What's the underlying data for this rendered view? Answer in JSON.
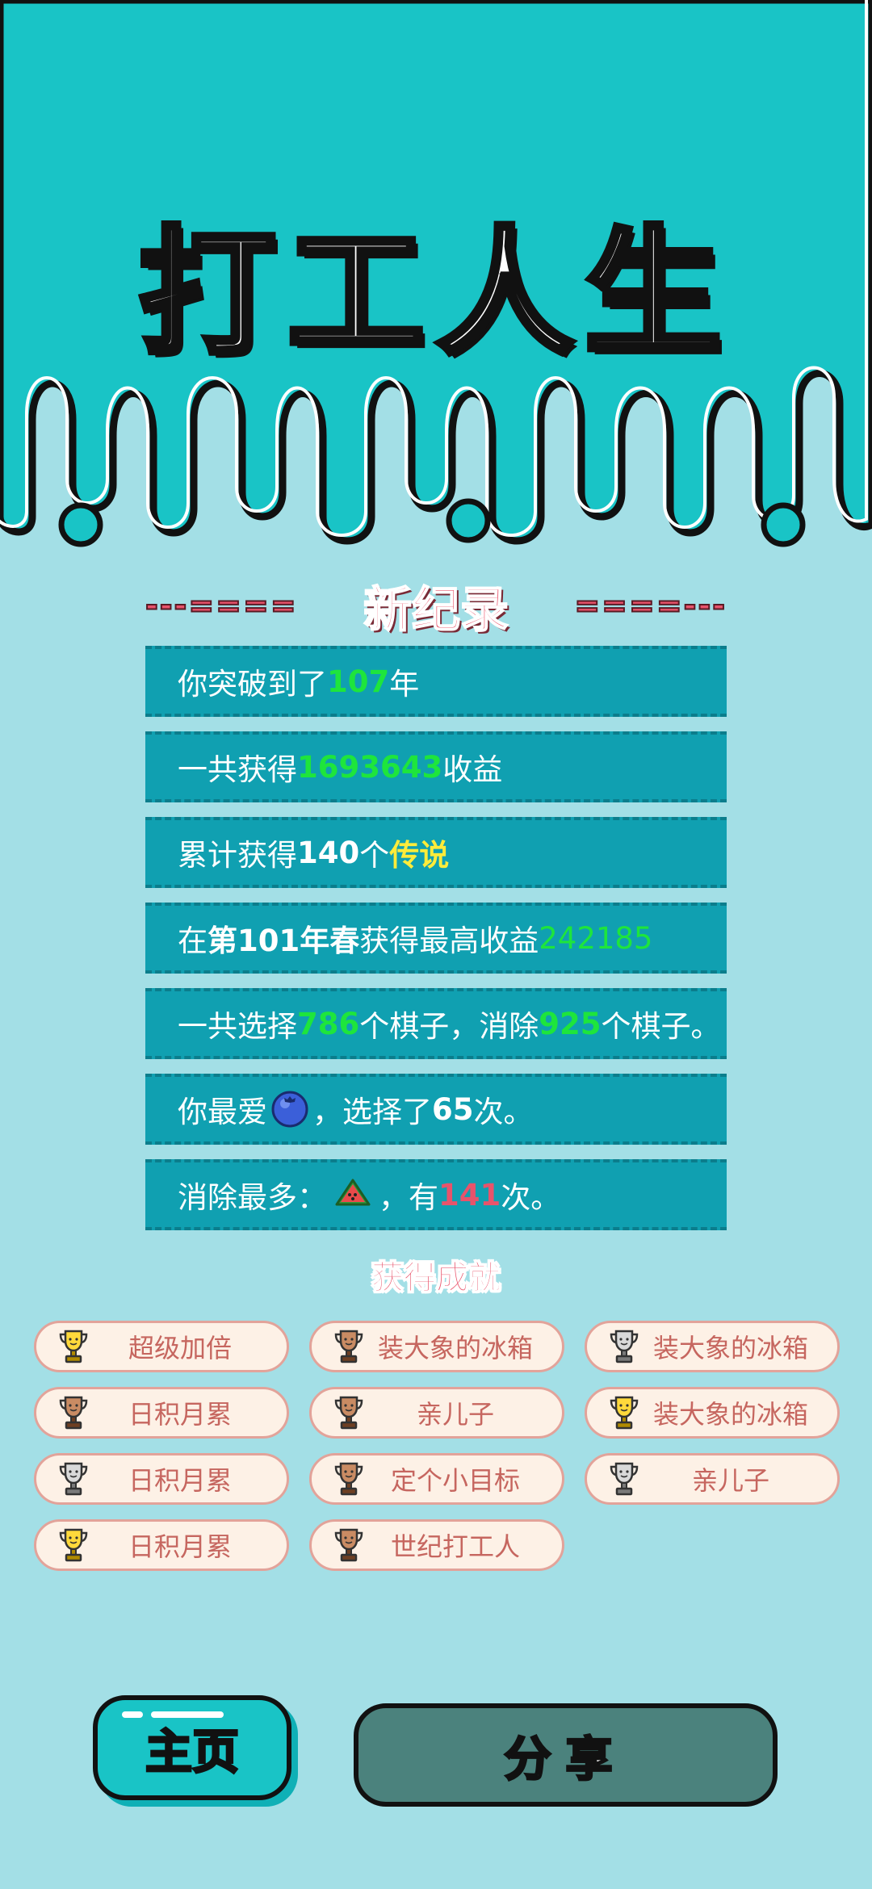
{
  "title": "打工人生",
  "record": {
    "dashes_left": "---====",
    "title": "新纪录",
    "dashes_right": "====---"
  },
  "stats": {
    "years": {
      "pre": "你突破到了",
      "value": "107",
      "post": "年"
    },
    "income": {
      "pre": "一共获得",
      "value": "1693643",
      "post": "收益"
    },
    "legend": {
      "pre": "累计获得",
      "count": "140",
      "mid": "个",
      "tag": "传说"
    },
    "best": {
      "pre": "在 ",
      "season": "第101年春",
      "mid": " 获得最高收益",
      "value": "242185"
    },
    "pieces": {
      "pre": "一共选择",
      "chosen": "786",
      "mid": "个棋子，消除",
      "removed": "925",
      "post": "个棋子。"
    },
    "favorite": {
      "pre": "你最爱",
      "mid": "，选择了",
      "count": "65",
      "post": "次。",
      "icon": "blueberry-icon"
    },
    "most_removed": {
      "pre": "消除最多：",
      "mid": "，有",
      "count": "141",
      "post": "次。",
      "icon": "watermelon-icon"
    }
  },
  "achievements": {
    "title": "获得成就",
    "items": [
      {
        "label": "超级加倍",
        "tier": "gold"
      },
      {
        "label": "装大象的冰箱",
        "tier": "bronze"
      },
      {
        "label": "装大象的冰箱",
        "tier": "silver"
      },
      {
        "label": "日积月累",
        "tier": "bronze"
      },
      {
        "label": "亲儿子",
        "tier": "bronze"
      },
      {
        "label": "装大象的冰箱",
        "tier": "gold"
      },
      {
        "label": "日积月累",
        "tier": "silver"
      },
      {
        "label": "定个小目标",
        "tier": "bronze"
      },
      {
        "label": "亲儿子",
        "tier": "silver"
      },
      {
        "label": "日积月累",
        "tier": "gold"
      },
      {
        "label": "世纪打工人",
        "tier": "bronze"
      }
    ]
  },
  "buttons": {
    "home": "主页",
    "share": "分享"
  },
  "colors": {
    "header": "#19c4c6",
    "background": "#a3dfe6",
    "row": "#10a0b1",
    "accent_green": "#1ee53c",
    "accent_yellow": "#ffec3a",
    "accent_red": "#e8536b"
  }
}
